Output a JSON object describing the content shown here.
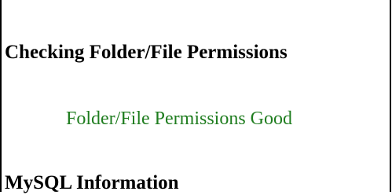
{
  "sections": {
    "permissions": {
      "heading": "Checking Folder/File Permissions",
      "status": "Folder/File Permissions Good"
    },
    "mysql": {
      "heading": "MySQL Information"
    }
  },
  "colors": {
    "status_good": "#1f7d1f",
    "heading_text": "#000000",
    "background": "#ffffff",
    "frame": "#000000"
  }
}
